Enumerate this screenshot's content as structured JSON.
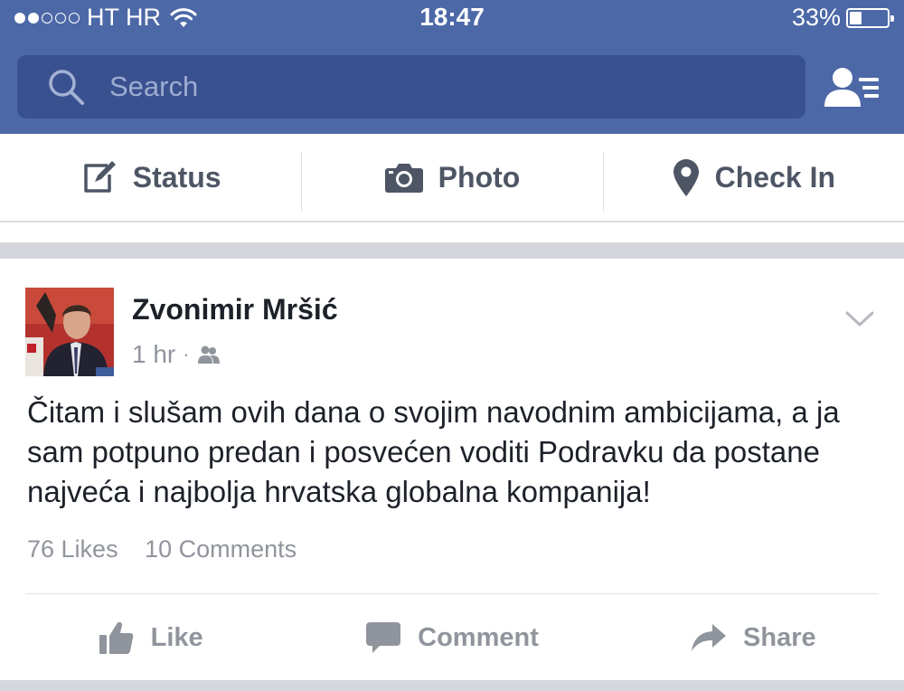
{
  "status_bar": {
    "carrier": "HT HR",
    "time": "18:47",
    "battery_percent": "33%",
    "battery_level": 0.33,
    "signal_bars_filled": 2,
    "signal_bars_total": 5
  },
  "search": {
    "placeholder": "Search"
  },
  "composer": {
    "status_label": "Status",
    "photo_label": "Photo",
    "checkin_label": "Check In"
  },
  "post": {
    "author": "Zvonimir Mršić",
    "time": "1 hr",
    "separator": "·",
    "text": "Čitam i slušam ovih dana o svojim navodnim ambicijama, a ja sam potpuno predan i posvećen voditi Podravku da postane najveća i najbolja hrvatska globalna kompanija!",
    "likes": "76 Likes",
    "comments": "10 Comments",
    "actions": {
      "like": "Like",
      "comment": "Comment",
      "share": "Share"
    }
  },
  "colors": {
    "header_bg": "#4c68a7",
    "search_bg": "#3a5190",
    "text_dark": "#1d2129",
    "text_gray": "#90949c",
    "separator": "#d4d6db"
  },
  "icons": [
    "signal-dots",
    "wifi-icon",
    "battery-icon",
    "search-icon",
    "friend-requests-icon",
    "status-edit-icon",
    "camera-icon",
    "location-pin-icon",
    "friends-audience-icon",
    "chevron-down-icon",
    "like-thumb-icon",
    "comment-bubble-icon",
    "share-arrow-icon"
  ]
}
